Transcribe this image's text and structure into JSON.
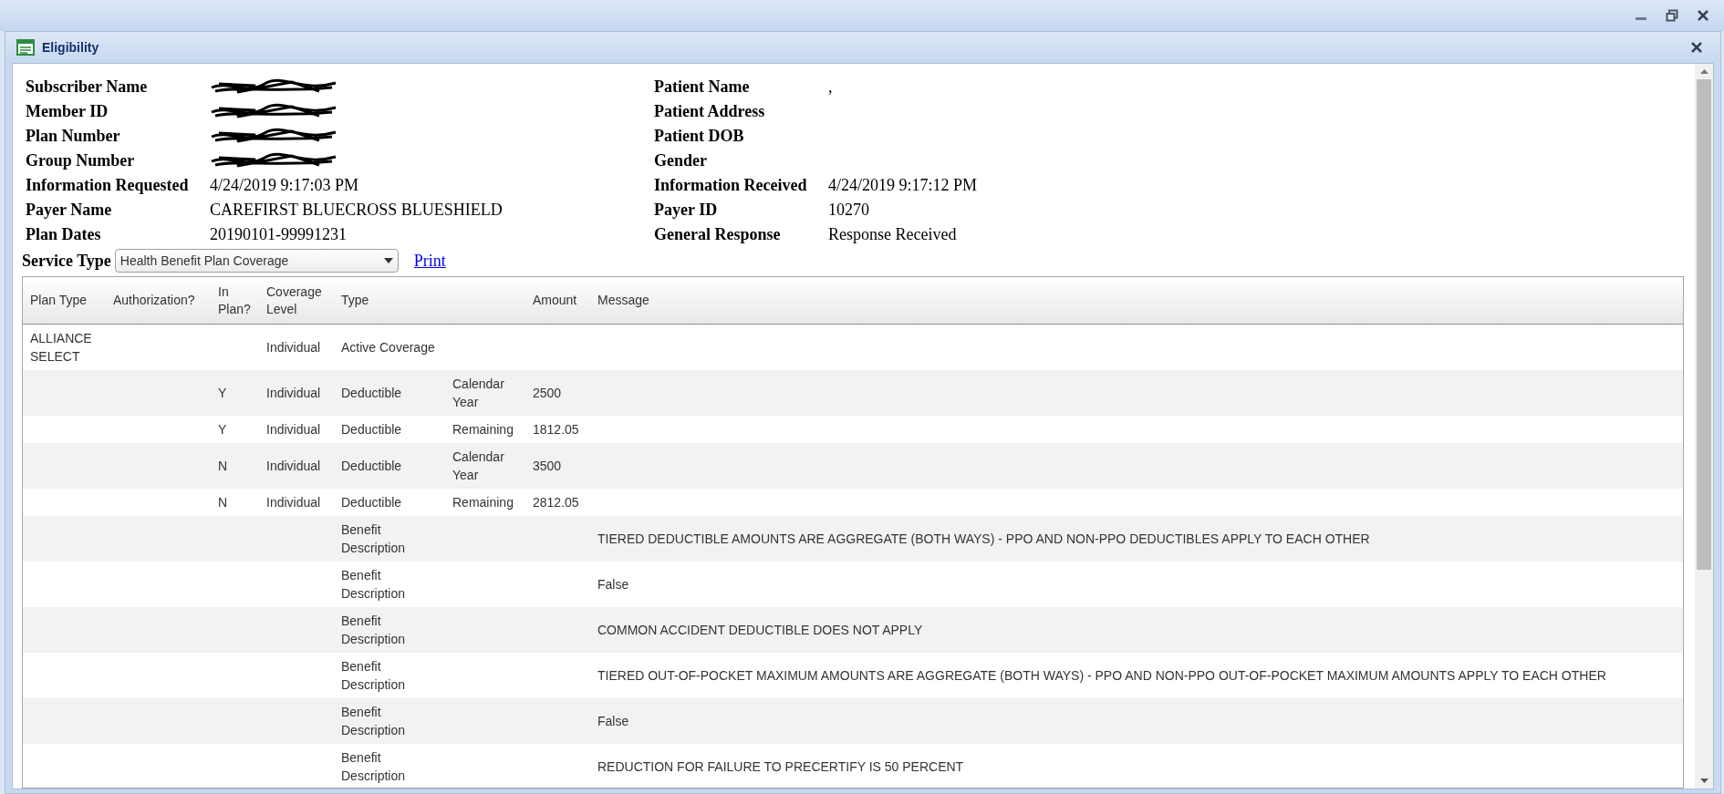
{
  "dialog": {
    "title": "Eligibility"
  },
  "left_fields": [
    {
      "label": "Subscriber Name",
      "redacted": true
    },
    {
      "label": "Member ID",
      "redacted": true
    },
    {
      "label": "Plan Number",
      "redacted": true
    },
    {
      "label": "Group Number",
      "redacted": true
    },
    {
      "label": "Information Requested",
      "value": "4/24/2019 9:17:03 PM",
      "redacted": false
    },
    {
      "label": "Payer Name",
      "value": "CAREFIRST BLUECROSS BLUESHIELD",
      "redacted": false
    },
    {
      "label": "Plan Dates",
      "value": "20190101-99991231",
      "redacted": false
    }
  ],
  "right_fields": [
    {
      "label": "Patient Name",
      "value": ","
    },
    {
      "label": "Patient Address"
    },
    {
      "label": "Patient DOB"
    },
    {
      "label": "Gender"
    },
    {
      "label": "Information Received",
      "value": "4/24/2019 9:17:12 PM"
    },
    {
      "label": "Payer ID",
      "value": "10270"
    },
    {
      "label": "General Response",
      "value": "Response Received"
    }
  ],
  "service_type": {
    "label": "Service Type",
    "value": "Health Benefit Plan Coverage"
  },
  "print_link": "Print",
  "table": {
    "columns": [
      "Plan Type",
      "Authorization?",
      "In Plan?",
      "Coverage Level",
      "Type",
      null,
      "Amount",
      "Message"
    ],
    "rows": [
      [
        "ALLIANCE SELECT",
        null,
        null,
        "Individual",
        "Active Coverage",
        null,
        null,
        null
      ],
      [
        null,
        null,
        "Y",
        "Individual",
        "Deductible",
        "Calendar Year",
        "2500",
        null
      ],
      [
        null,
        null,
        "Y",
        "Individual",
        "Deductible",
        "Remaining",
        "1812.05",
        null
      ],
      [
        null,
        null,
        "N",
        "Individual",
        "Deductible",
        "Calendar Year",
        "3500",
        null
      ],
      [
        null,
        null,
        "N",
        "Individual",
        "Deductible",
        "Remaining",
        "2812.05",
        null
      ],
      [
        null,
        null,
        null,
        null,
        "Benefit Description",
        null,
        null,
        "TIERED DEDUCTIBLE AMOUNTS ARE AGGREGATE (BOTH WAYS) - PPO AND NON-PPO DEDUCTIBLES APPLY TO EACH OTHER"
      ],
      [
        null,
        null,
        null,
        null,
        "Benefit Description",
        null,
        null,
        "False"
      ],
      [
        null,
        null,
        null,
        null,
        "Benefit Description",
        null,
        null,
        "COMMON ACCIDENT DEDUCTIBLE DOES NOT APPLY"
      ],
      [
        null,
        null,
        null,
        null,
        "Benefit Description",
        null,
        null,
        "TIERED OUT-OF-POCKET MAXIMUM AMOUNTS ARE AGGREGATE (BOTH WAYS) - PPO AND NON-PPO OUT-OF-POCKET MAXIMUM AMOUNTS APPLY TO EACH OTHER"
      ],
      [
        null,
        null,
        null,
        null,
        "Benefit Description",
        null,
        null,
        "False"
      ],
      [
        null,
        null,
        null,
        null,
        "Benefit Description",
        null,
        null,
        "REDUCTION FOR FAILURE TO PRECERTIFY IS 50 PERCENT"
      ]
    ]
  }
}
